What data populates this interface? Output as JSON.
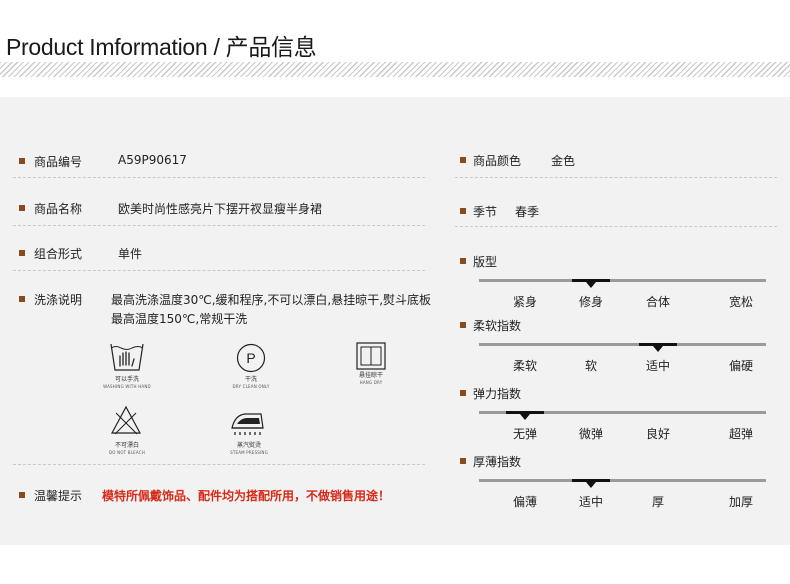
{
  "header": {
    "title": "Product Imformation / 产品信息"
  },
  "left": {
    "code": {
      "label": "商品编号",
      "value": "A59P90617"
    },
    "name": {
      "label": "商品名称",
      "value": "欧美时尚性感亮片下摆开衩显瘦半身裙"
    },
    "combo": {
      "label": "组合形式",
      "value": "单件"
    },
    "wash": {
      "label": "洗涤说明",
      "value": "最高洗涤温度30℃,缓和程序,不可以漂白,悬挂晾干,熨斗底板最高温度150℃,常规干洗"
    },
    "care_icons": [
      {
        "icon": "hand-wash-icon",
        "zh": "可以手洗",
        "en": "WASHING WITH HAND"
      },
      {
        "icon": "dry-clean-icon",
        "symbol": "P",
        "zh": "干洗",
        "en": "DRY CLEAN ONLY"
      },
      {
        "icon": "hang-dry-icon",
        "zh": "悬挂晾干",
        "en": "HANG DRY"
      },
      {
        "icon": "no-bleach-icon",
        "zh": "不可漂白",
        "en": "DO NOT BLEACH"
      },
      {
        "icon": "steam-iron-icon",
        "zh": "蒸汽熨烫",
        "en": "STEAM PRESSING"
      }
    ],
    "notice": {
      "label": "温馨提示",
      "value": "模特所佩戴饰品、配件均为搭配所用，不做销售用途！"
    }
  },
  "right": {
    "color": {
      "label": "商品颜色",
      "value": "金色"
    },
    "season": {
      "label": "季节",
      "value": "春季"
    },
    "scales": [
      {
        "label": "版型",
        "options": [
          "紧身",
          "修身",
          "合体",
          "宽松"
        ],
        "selected": 1
      },
      {
        "label": "柔软指数",
        "options": [
          "柔软",
          "软",
          "适中",
          "偏硬"
        ],
        "selected": 2
      },
      {
        "label": "弹力指数",
        "options": [
          "无弹",
          "微弹",
          "良好",
          "超弹"
        ],
        "selected": 0
      },
      {
        "label": "厚薄指数",
        "options": [
          "偏薄",
          "适中",
          "厚",
          "加厚"
        ],
        "selected": 1
      }
    ]
  },
  "colors": {
    "accent": "#8b4a1e",
    "notice": "#d62a1a",
    "panel": "#f2f2f2"
  }
}
